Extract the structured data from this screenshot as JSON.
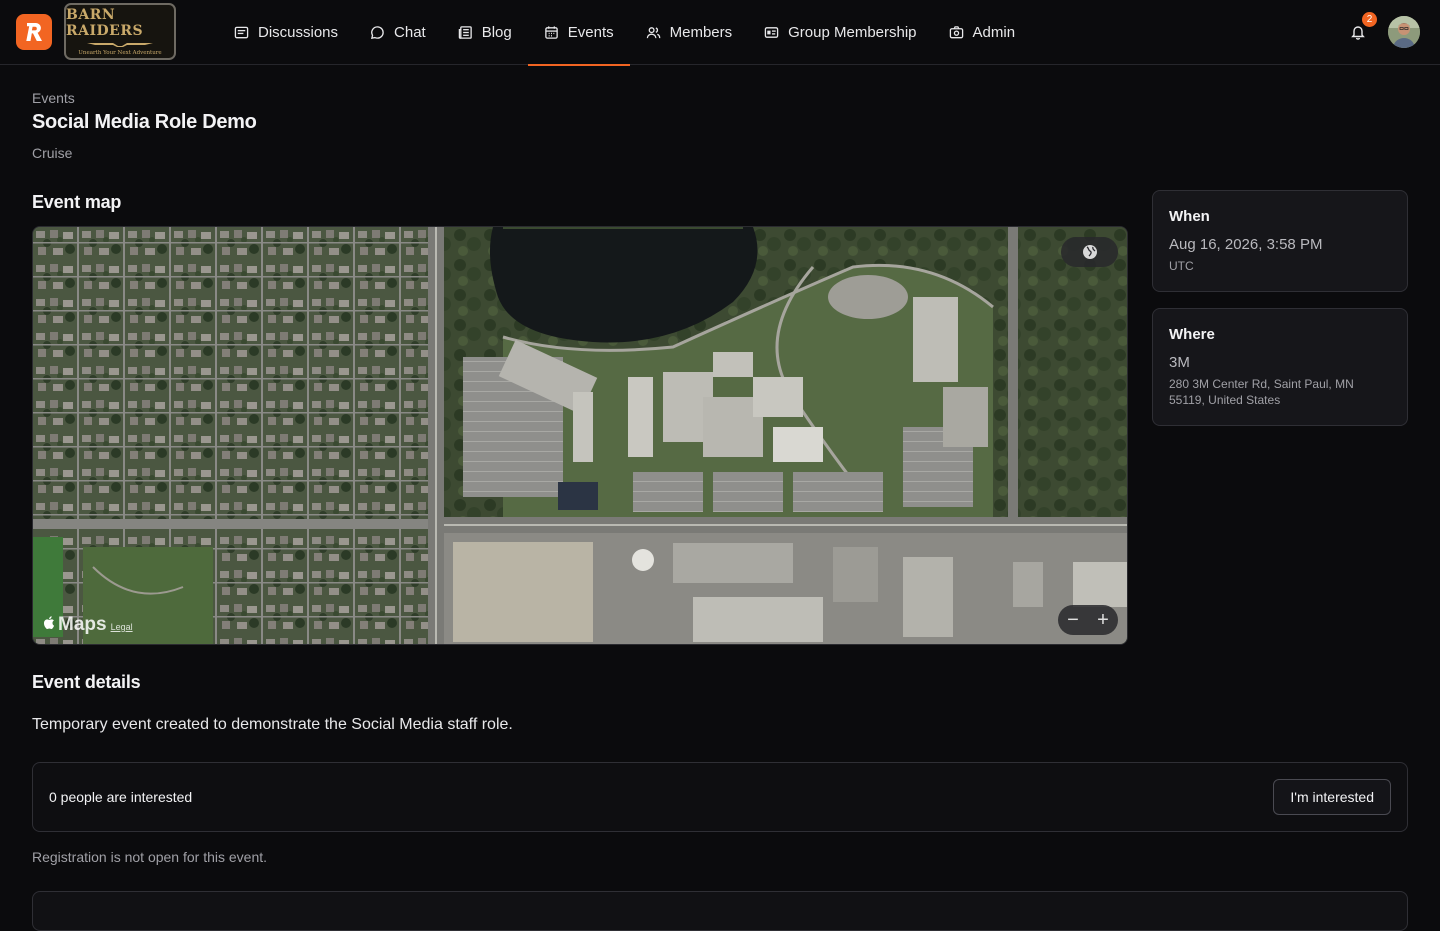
{
  "brand": {
    "app_icon": "r-logo-icon",
    "club_name": "BARN RAIDERS",
    "club_tagline": "Unearth Your Next Adventure"
  },
  "nav": {
    "items": [
      {
        "label": "Discussions",
        "icon": "list-icon"
      },
      {
        "label": "Chat",
        "icon": "chat-bubble-icon"
      },
      {
        "label": "Blog",
        "icon": "newspaper-icon"
      },
      {
        "label": "Events",
        "icon": "calendar-icon",
        "active": true
      },
      {
        "label": "Members",
        "icon": "users-icon"
      },
      {
        "label": "Group Membership",
        "icon": "id-card-icon"
      },
      {
        "label": "Admin",
        "icon": "camera-icon"
      }
    ],
    "notification_count": "2"
  },
  "page": {
    "breadcrumb": "Events",
    "title": "Social Media Role Demo",
    "event_type": "Cruise"
  },
  "map_section": {
    "title": "Event map",
    "brand": "Maps",
    "legal": "Legal",
    "zoom_out": "−",
    "zoom_in": "+"
  },
  "when": {
    "title": "When",
    "datetime": "Aug 16, 2026, 3:58 PM",
    "timezone": "UTC"
  },
  "where": {
    "title": "Where",
    "place": "3M",
    "address": "280 3M Center Rd, Saint Paul, MN 55119, United States"
  },
  "details": {
    "title": "Event details",
    "description": "Temporary event created to demonstrate the Social Media staff role.",
    "interested_count": "0 people are interested",
    "interested_button": "I'm interested",
    "registration_note": "Registration is not open for this event."
  },
  "colors": {
    "accent": "#f26522",
    "background": "#0b0b0d"
  }
}
